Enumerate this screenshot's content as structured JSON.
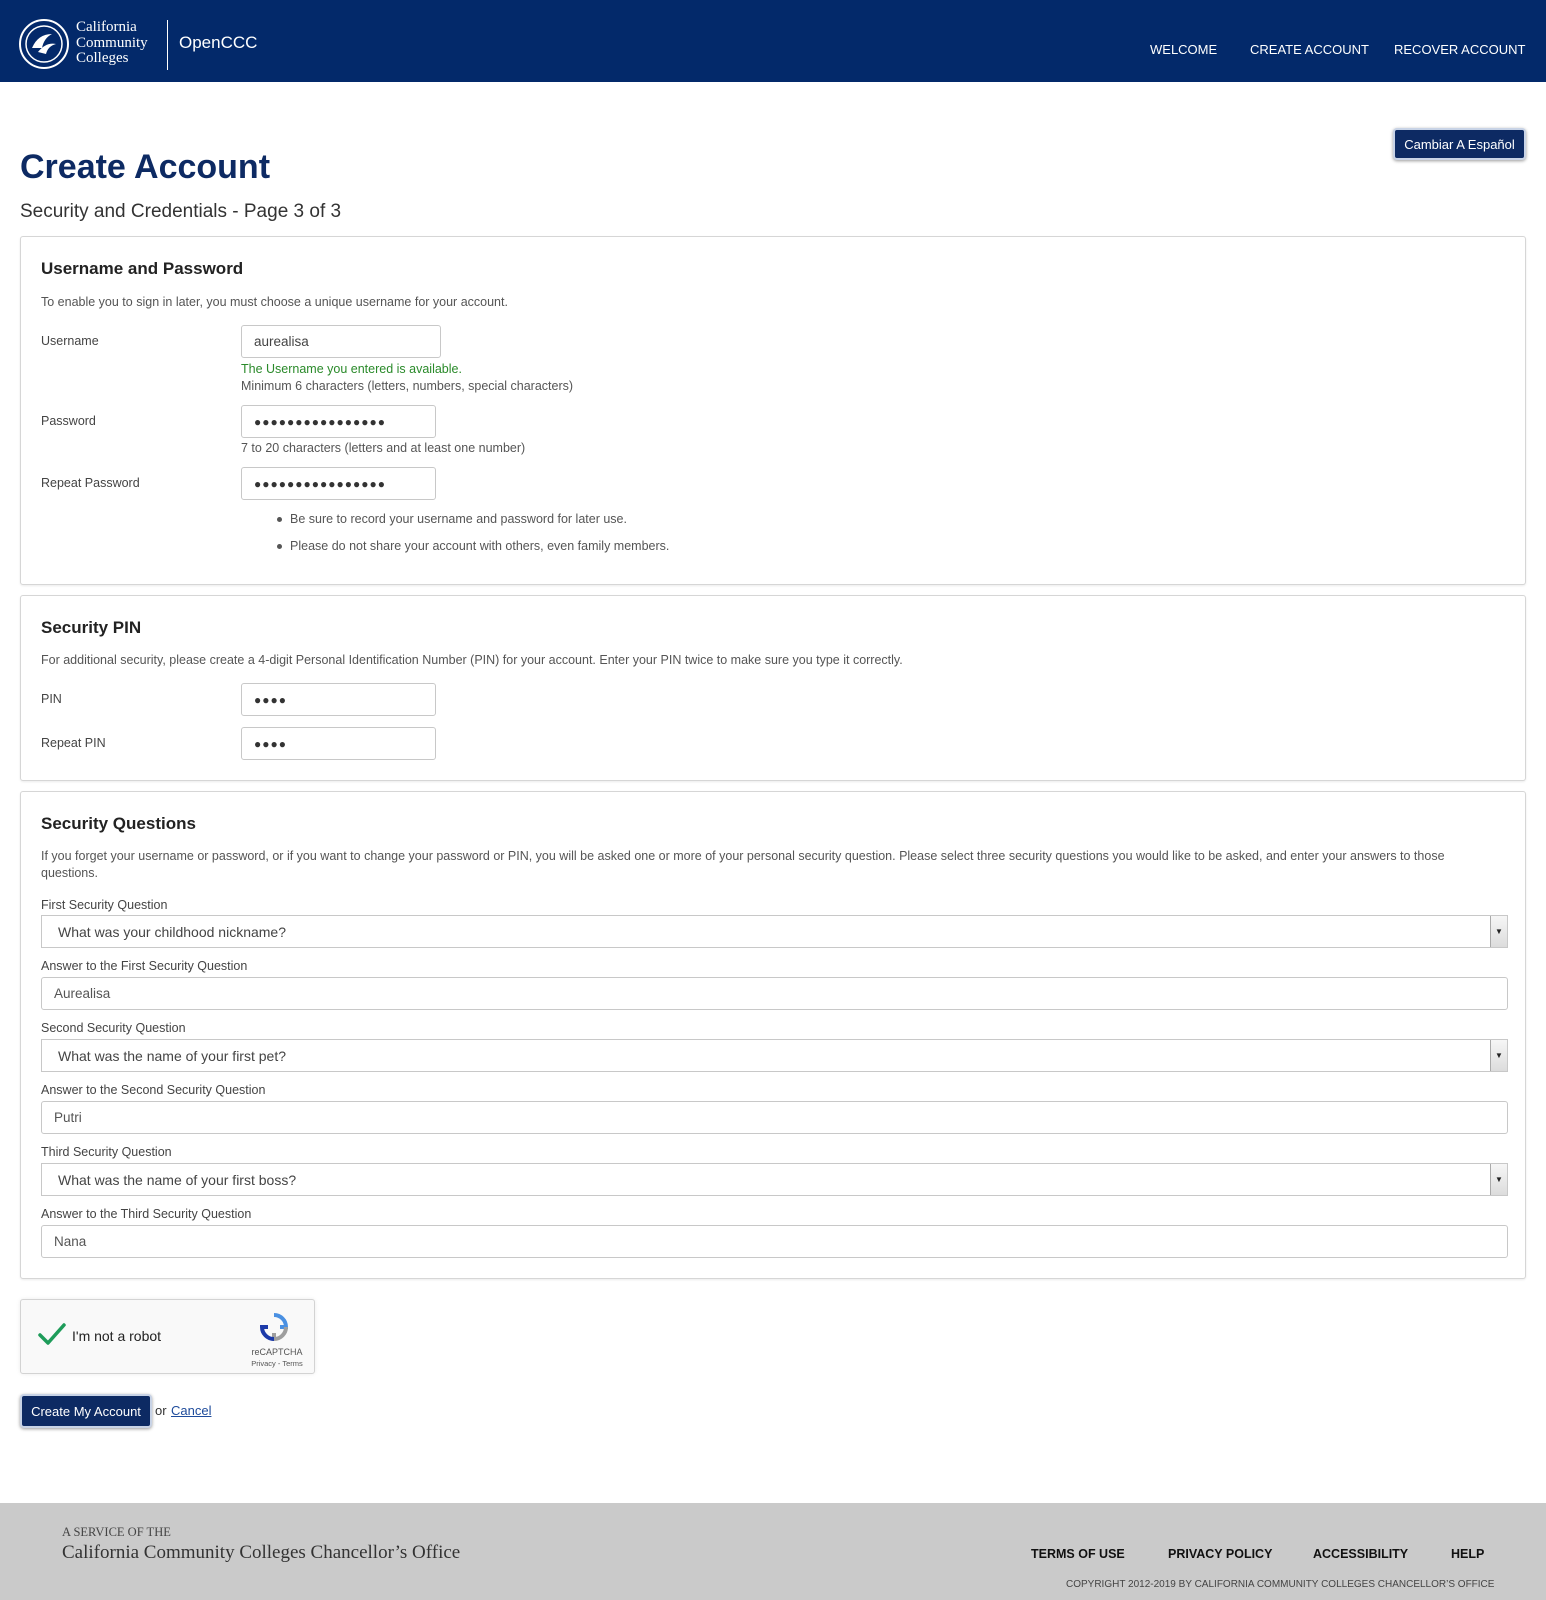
{
  "header": {
    "logo_lines": [
      "California",
      "Community",
      "Colleges"
    ],
    "app_name": "OpenCCC",
    "nav": [
      "WELCOME",
      "CREATE ACCOUNT",
      "RECOVER ACCOUNT"
    ]
  },
  "language_button": "Cambiar A Español",
  "page": {
    "title": "Create Account",
    "subtitle": "Security and Credentials - Page 3 of 3"
  },
  "credentials": {
    "title": "Username and Password",
    "description": "To enable you to sign in later, you must choose a unique username for your account.",
    "username_label": "Username",
    "username_value": "aurealisa",
    "username_status": "The Username you entered is available.",
    "username_hint": "Minimum 6 characters (letters, numbers, special characters)",
    "password_label": "Password",
    "password_mask": "●●●●●●●●●●●●●●●●",
    "password_hint": "7 to 20 characters (letters and at least one number)",
    "repeat_password_label": "Repeat Password",
    "repeat_password_mask": "●●●●●●●●●●●●●●●●",
    "notes": [
      "Be sure to record your username and password for later use.",
      "Please do not share your account with others, even family members."
    ]
  },
  "pin": {
    "title": "Security PIN",
    "description": "For additional security, please create a 4-digit Personal Identification Number (PIN) for your account. Enter your PIN twice to make sure you type it correctly.",
    "pin_label": "PIN",
    "pin_mask": "●●●●",
    "repeat_pin_label": "Repeat PIN",
    "repeat_pin_mask": "●●●●"
  },
  "questions": {
    "title": "Security Questions",
    "description": "If you forget your username or password, or if you want to change your password or PIN, you will be asked one or more of your personal security question. Please select three security questions you would like to be asked, and enter your answers to those questions.",
    "items": [
      {
        "question_label": "First Security Question",
        "question": "What was your childhood nickname?",
        "answer_label": "Answer to the First Security Question",
        "answer": "Aurealisa"
      },
      {
        "question_label": "Second Security Question",
        "question": "What was the name of your first pet?",
        "answer_label": "Answer to the Second Security Question",
        "answer": "Putri"
      },
      {
        "question_label": "Third Security Question",
        "question": "What was the name of your first boss?",
        "answer_label": "Answer to the Third Security Question",
        "answer": "Nana"
      }
    ]
  },
  "recaptcha": {
    "label": "I'm not a robot",
    "brand": "reCAPTCHA",
    "links": "Privacy - Terms",
    "checked": true
  },
  "actions": {
    "create": "Create My Account",
    "or": "or",
    "cancel": "Cancel"
  },
  "footer": {
    "service": "A SERVICE OF THE",
    "office": "California Community Colleges Chancellor’s Office",
    "links": [
      "TERMS OF USE",
      "PRIVACY POLICY",
      "ACCESSIBILITY",
      "HELP"
    ],
    "copyright": "COPYRIGHT 2012-2019 BY CALIFORNIA COMMUNITY COLLEGES CHANCELLOR’S OFFICE"
  },
  "colors": {
    "header_bg": "#03296a",
    "title": "#0d2a63",
    "success": "#2a8a2a",
    "footer_bg": "#cacaca"
  }
}
